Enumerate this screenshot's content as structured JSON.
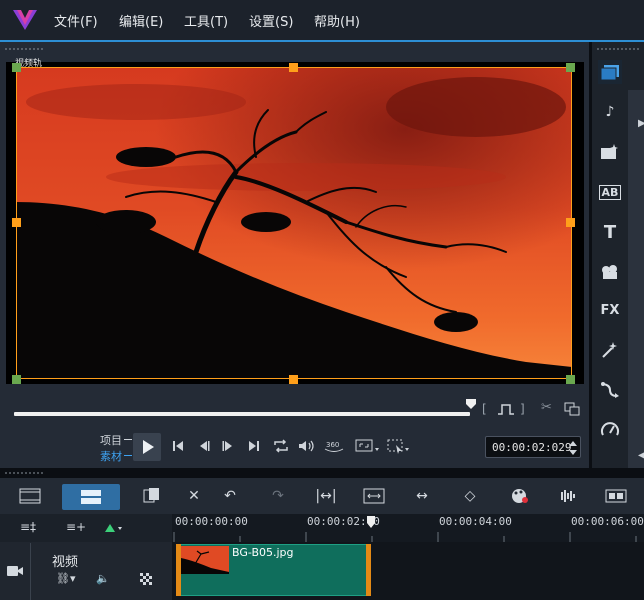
{
  "menu": {
    "items": [
      "文件(F)",
      "编辑(E)",
      "工具(T)",
      "设置(S)",
      "帮助(H)"
    ]
  },
  "preview": {
    "overlay_label": "视频轨",
    "mode_project": "项目",
    "mode_clip": "素材",
    "timecode": "00:00:02:029",
    "progress": 1.0
  },
  "library": {
    "icons": [
      "media-icon",
      "audio-icon",
      "instant-project-icon",
      "transition-icon",
      "title-icon",
      "graphic-icon",
      "filter-icon",
      "motion-icon",
      "path-icon",
      "speed-icon"
    ],
    "labels": {
      "transition": "AB",
      "title": "T",
      "filter": "FX"
    }
  },
  "timeline": {
    "ruler": [
      "00:00:00:00",
      "00:00:02:00",
      "00:00:04:00",
      "00:00:06:00"
    ],
    "track_name": "视频",
    "clip_name": "BG-B05.jpg"
  },
  "colors": {
    "accent": "#2d8fd5",
    "handle": "#ff9f1a",
    "clip": "#0f6e5c"
  }
}
